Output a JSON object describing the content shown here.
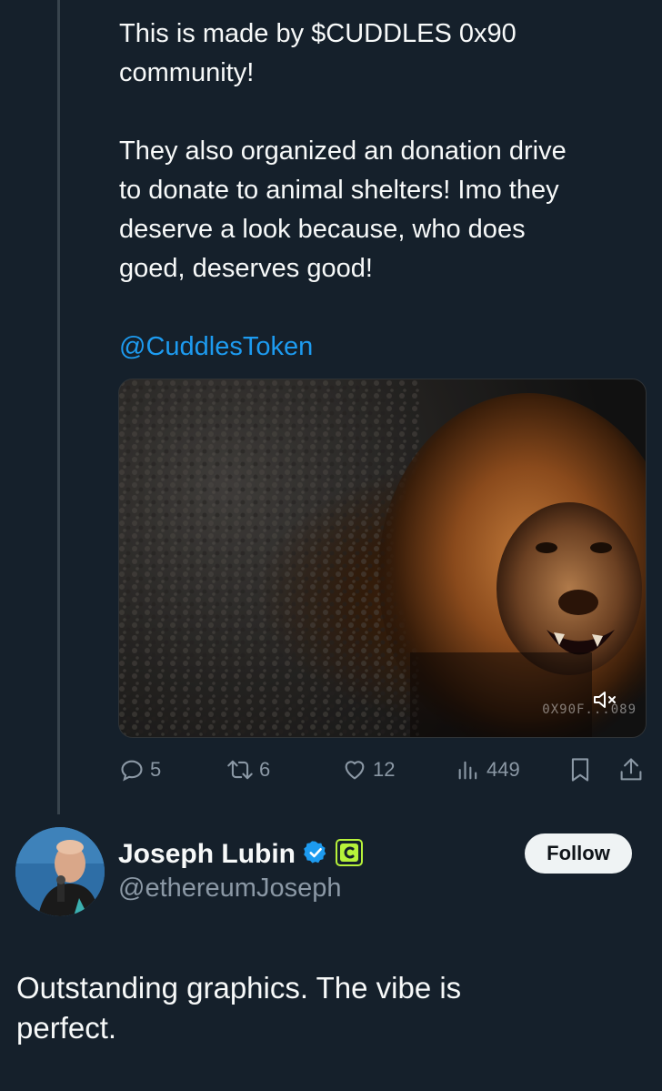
{
  "post": {
    "lines": [
      "This is made by $CUDDLES 0x90",
      "community!",
      "They also organized an donation drive",
      "to donate to animal shelters! Imo they",
      "deserve a look because, who does",
      "goed, deserves good!"
    ],
    "mention": "@CuddlesToken",
    "media": {
      "watermark": "0X90F...089",
      "mute_icon": "speaker-muted-icon"
    },
    "actions": {
      "replies": "5",
      "reposts": "6",
      "likes": "12",
      "views": "449"
    }
  },
  "reply": {
    "author_name": "Joseph Lubin",
    "author_handle": "@ethereumJoseph",
    "verified_badge": "verified-badge-icon",
    "affiliate_badge": "affiliate-badge-icon",
    "follow_label": "Follow",
    "text_lines": [
      "Outstanding graphics.  The vibe is",
      "perfect."
    ]
  },
  "colors": {
    "background": "#15202b",
    "accent": "#1d9bf0",
    "muted": "#8b98a5",
    "affiliate_badge": "#b7f23a"
  }
}
